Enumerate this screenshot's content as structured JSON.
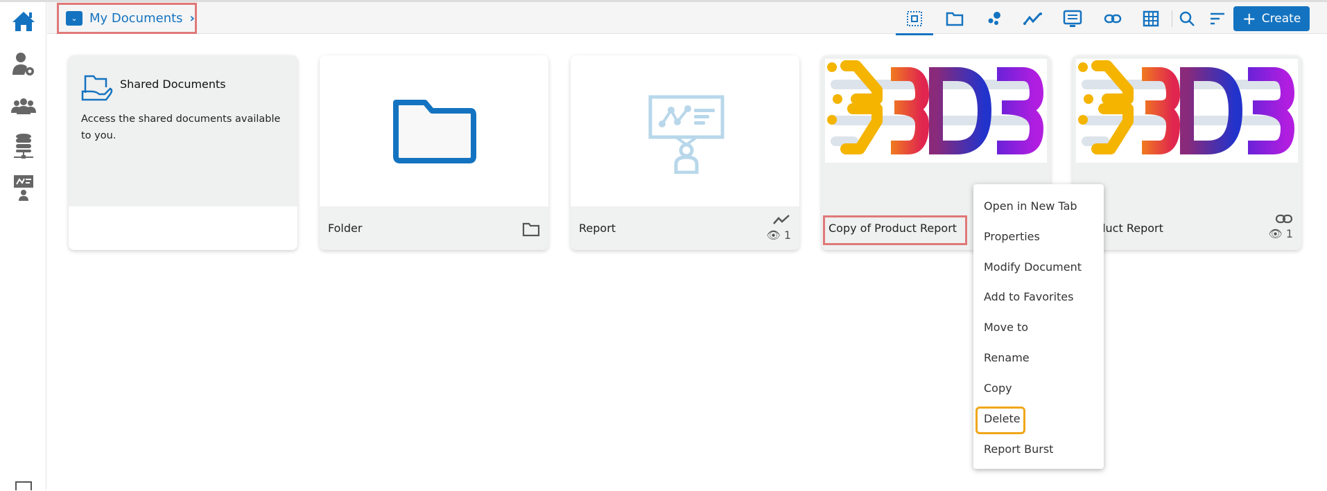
{
  "breadcrumb": {
    "label": "My Documents"
  },
  "toolbar": {
    "create_label": "Create",
    "buttons": [
      "select-all",
      "folder",
      "scatter",
      "line-chart",
      "presentation",
      "link",
      "grid",
      "search",
      "sort"
    ]
  },
  "sidebar": {
    "items": [
      "home",
      "user-settings",
      "users",
      "data-connectors",
      "report-presenter"
    ]
  },
  "cards": [
    {
      "title": "Shared Documents",
      "description": "Access the shared documents available to you."
    },
    {
      "name": "Folder",
      "type_icon": "folder-icon"
    },
    {
      "name": "Report",
      "type_icon": "line-chart-icon",
      "views": "1"
    },
    {
      "name": "Copy of Product Report"
    },
    {
      "name": "Product Report",
      "type_icon": "link-icon",
      "views": "1"
    }
  ],
  "context_menu": {
    "items": [
      "Open in New Tab",
      "Properties",
      "Modify Document",
      "Add to Favorites",
      "Move to",
      "Rename",
      "Copy",
      "Delete",
      "Report Burst"
    ]
  },
  "colors": {
    "accent": "#1473c0",
    "highlight_red": "#e07878",
    "highlight_orange": "#f0a71a"
  }
}
